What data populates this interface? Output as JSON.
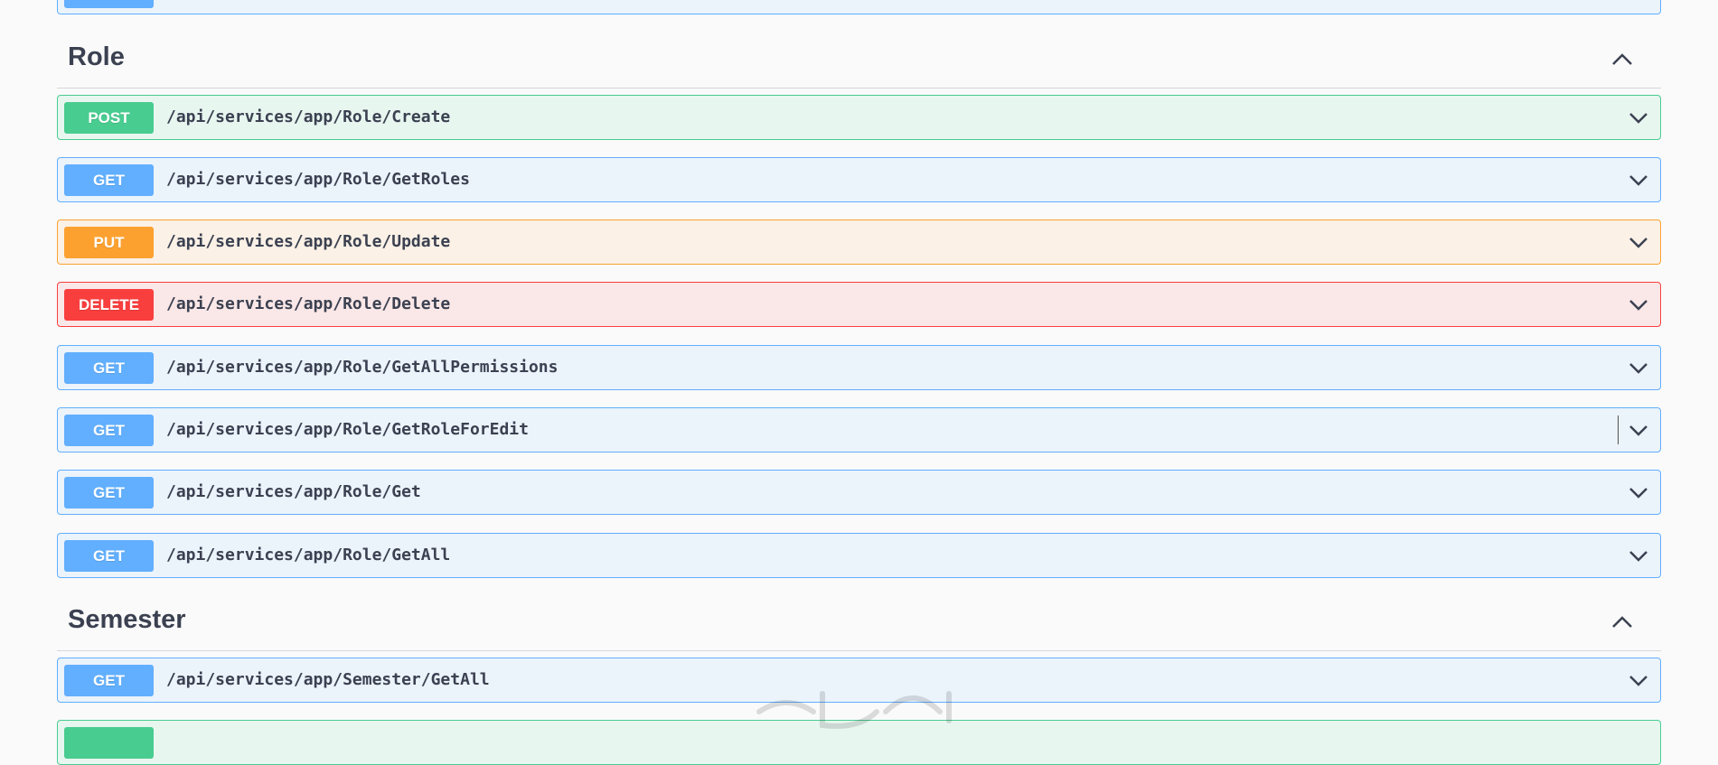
{
  "role_section": {
    "title": "Role",
    "operations": [
      {
        "method": "POST",
        "path": "/api/services/app/Role/Create"
      },
      {
        "method": "GET",
        "path": "/api/services/app/Role/GetRoles"
      },
      {
        "method": "PUT",
        "path": "/api/services/app/Role/Update"
      },
      {
        "method": "DELETE",
        "path": "/api/services/app/Role/Delete"
      },
      {
        "method": "GET",
        "path": "/api/services/app/Role/GetAllPermissions"
      },
      {
        "method": "GET",
        "path": "/api/services/app/Role/GetRoleForEdit"
      },
      {
        "method": "GET",
        "path": "/api/services/app/Role/Get"
      },
      {
        "method": "GET",
        "path": "/api/services/app/Role/GetAll"
      }
    ]
  },
  "semester_section": {
    "title": "Semester",
    "operations": [
      {
        "method": "GET",
        "path": "/api/services/app/Semester/GetAll"
      }
    ]
  },
  "colors": {
    "get": "#61affe",
    "post": "#49cc90",
    "put": "#fca130",
    "delete": "#f93e3e"
  },
  "icons": {
    "expand": "chevron-down-icon",
    "collapse": "chevron-up-icon"
  }
}
